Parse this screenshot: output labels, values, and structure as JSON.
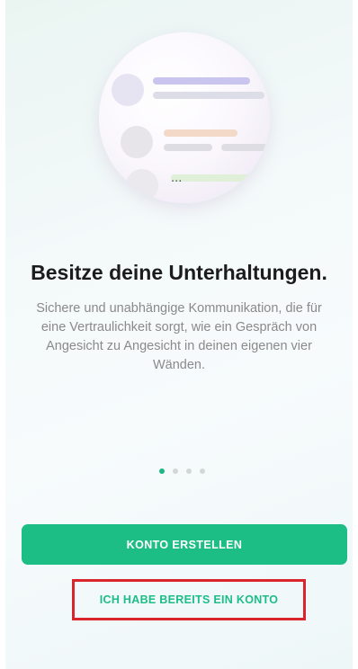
{
  "onboarding": {
    "title": "Besitze deine Unterhaltungen.",
    "description": "Sichere und unabhängige Kommunikation, die für eine Vertraulichkeit sorgt, wie ein Gespräch von Angesicht zu Angesicht in deinen eigenen vier Wänden.",
    "illustration_ellipsis": "...",
    "pager": {
      "total_pages": 4,
      "current_page": 1
    }
  },
  "actions": {
    "create_account_label": "KONTO ERSTELLEN",
    "existing_account_label": "ICH HABE BEREITS EIN KONTO"
  },
  "colors": {
    "accent": "#1dbd86",
    "highlight_border": "#d9252b",
    "title_text": "#1c1c1c",
    "body_text": "#8a8a8a"
  }
}
